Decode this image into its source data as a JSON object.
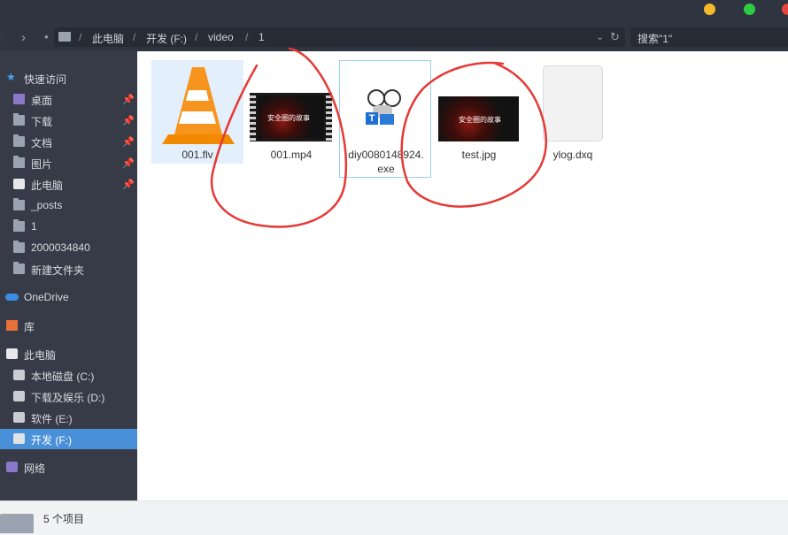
{
  "window": {
    "controls": [
      "#f5b92a",
      "#2ecc40",
      "#e8453c"
    ]
  },
  "address": {
    "crumbs": [
      "此电脑",
      "开发 (F:)",
      "video",
      "1"
    ],
    "search_placeholder": "搜索\"1\""
  },
  "sidebar": {
    "items": [
      {
        "label": "快速访问",
        "icon": "star-icon",
        "pinned": false
      },
      {
        "label": "桌面",
        "icon": "desktop-folder-icon",
        "pinned": true
      },
      {
        "label": "下载",
        "icon": "download-folder-icon",
        "pinned": true
      },
      {
        "label": "文档",
        "icon": "documents-folder-icon",
        "pinned": true
      },
      {
        "label": "图片",
        "icon": "pictures-folder-icon",
        "pinned": true
      },
      {
        "label": "此电脑",
        "icon": "computer-icon",
        "pinned": true
      },
      {
        "label": "_posts",
        "icon": "folder-icon",
        "pinned": false
      },
      {
        "label": "1",
        "icon": "folder-icon",
        "pinned": false
      },
      {
        "label": "2000034840",
        "icon": "folder-icon",
        "pinned": false
      },
      {
        "label": "新建文件夹",
        "icon": "folder-icon",
        "pinned": false
      },
      {
        "label": "OneDrive",
        "icon": "cloud-icon",
        "pinned": false
      },
      {
        "label": "库",
        "icon": "library-icon",
        "pinned": false
      },
      {
        "label": "此电脑",
        "icon": "computer-icon",
        "pinned": false
      },
      {
        "label": "本地磁盘 (C:)",
        "icon": "drive-icon",
        "pinned": false
      },
      {
        "label": "下载及娱乐 (D:)",
        "icon": "drive-icon",
        "pinned": false
      },
      {
        "label": "软件 (E:)",
        "icon": "drive-icon",
        "pinned": false
      },
      {
        "label": "开发 (F:)",
        "icon": "drive-icon",
        "pinned": false,
        "selected": true
      },
      {
        "label": "网络",
        "icon": "network-icon",
        "pinned": false
      }
    ]
  },
  "files": [
    {
      "name": "001.flv",
      "icon": "vlc-cone-icon",
      "selected": true
    },
    {
      "name": "001.mp4",
      "icon": "video-thumbnail",
      "caption": "安全圈的故事"
    },
    {
      "name": "diy0080148924.exe",
      "name_line1": "diy0080148924.",
      "name_line2": "exe",
      "icon": "exe-icon"
    },
    {
      "name": "test.jpg",
      "icon": "image-thumbnail",
      "caption": "安全圈的故事"
    },
    {
      "name": "ylog.dxq",
      "icon": "blank-file-icon"
    }
  ],
  "status": {
    "count_text": "5 个项目"
  },
  "colors": {
    "sidebar_bg": "#363b47",
    "selected_bg": "#4a90d9",
    "annotation": "#e53935"
  }
}
